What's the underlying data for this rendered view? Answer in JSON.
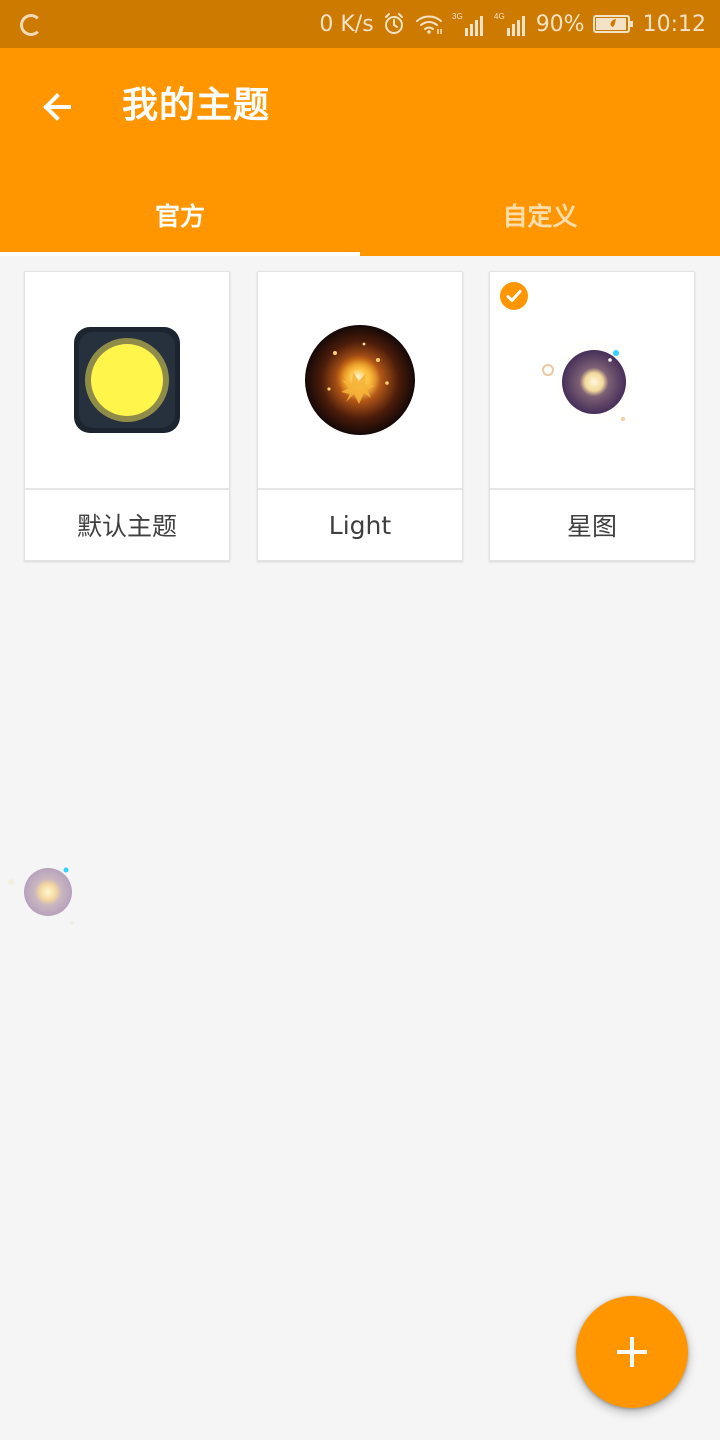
{
  "status_bar": {
    "speed": "0 K/s",
    "network_3g": "3G",
    "network_4g": "4G",
    "battery": "90%",
    "time": "10:12"
  },
  "header": {
    "title": "我的主题"
  },
  "tabs": [
    {
      "label": "官方",
      "selected": true
    },
    {
      "label": "自定义",
      "selected": false
    }
  ],
  "themes": [
    {
      "label": "默认主题",
      "icon": "yellow-circle-square-icon",
      "selected": false
    },
    {
      "label": "Light",
      "icon": "glowing-amber-orb-icon",
      "selected": false
    },
    {
      "label": "星图",
      "icon": "purple-star-planet-icon",
      "selected": true
    }
  ],
  "fab": {
    "icon": "plus-icon"
  },
  "colors": {
    "accent": "#ff9600",
    "status_bar": "#cc7a00",
    "background": "#f5f5f5",
    "card": "#ffffff",
    "text": "#3f3f3f"
  }
}
